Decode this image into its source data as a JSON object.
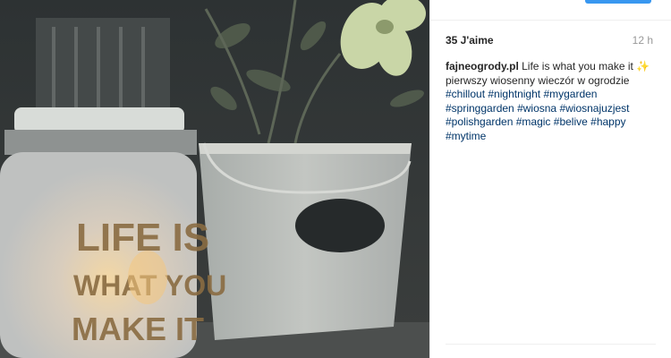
{
  "post": {
    "likes": "35 J'aime",
    "time": "12 h",
    "username": "fajneogrody.pl",
    "caption_line1": "Life is what you make it",
    "sparkle_emoji": "✨",
    "caption_line2": "pierwszy wiosenny wieczór w ogrodzie",
    "hashtags": [
      "#chillout",
      "#nightnight",
      "#mygarden",
      "#springgarden",
      "#wiosna",
      "#wiosnajuzjest",
      "#polishgarden",
      "#magic",
      "#belive",
      "#happy",
      "#mytime"
    ]
  },
  "photo": {
    "lantern_text": [
      "LIFE IS",
      "WHAT YOU",
      "MAKE IT"
    ]
  },
  "colors": {
    "tag_link": "#003569",
    "follow_button": "#3897f0",
    "muted_text": "#999999"
  }
}
